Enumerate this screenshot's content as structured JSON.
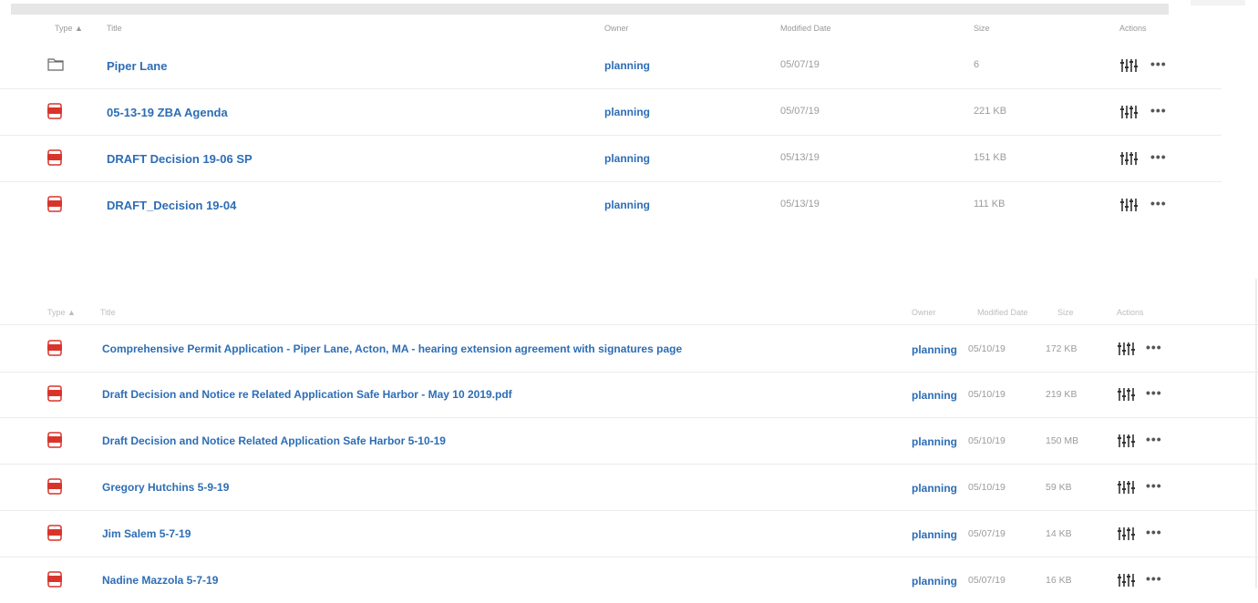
{
  "table_top": {
    "headers": {
      "type": "Type ▲",
      "title": "Title",
      "owner": "Owner",
      "modified": "Modified Date",
      "size": "Size",
      "actions": "Actions"
    },
    "rows": [
      {
        "icon": "folder-icon",
        "title": "Piper Lane",
        "owner": "planning",
        "modified": "05/07/19",
        "size": "6"
      },
      {
        "icon": "pdf-icon",
        "title": "05-13-19 ZBA Agenda",
        "owner": "planning",
        "modified": "05/07/19",
        "size": "221 KB"
      },
      {
        "icon": "pdf-icon",
        "title": "DRAFT Decision 19-06 SP",
        "owner": "planning",
        "modified": "05/13/19",
        "size": "151 KB"
      },
      {
        "icon": "pdf-icon",
        "title": "DRAFT_Decision 19-04",
        "owner": "planning",
        "modified": "05/13/19",
        "size": "111 KB"
      }
    ]
  },
  "table_bottom": {
    "headers": {
      "type": "Type ▲",
      "title": "Title",
      "owner": "Owner",
      "modified": "Modified Date",
      "size": "Size",
      "actions": "Actions"
    },
    "rows": [
      {
        "icon": "pdf-icon",
        "title": "Comprehensive Permit Application - Piper Lane, Acton, MA - hearing extension agreement with signatures page",
        "owner": "planning",
        "modified": "05/10/19",
        "size": "172 KB"
      },
      {
        "icon": "pdf-icon",
        "title": "Draft Decision and Notice re Related Application Safe Harbor - May 10 2019.pdf",
        "owner": "planning",
        "modified": "05/10/19",
        "size": "219 KB"
      },
      {
        "icon": "pdf-icon",
        "title": "Draft Decision and Notice Related Application Safe Harbor 5-10-19",
        "owner": "planning",
        "modified": "05/10/19",
        "size": "150 MB"
      },
      {
        "icon": "pdf-icon",
        "title": "Gregory Hutchins 5-9-19",
        "owner": "planning",
        "modified": "05/10/19",
        "size": "59 KB"
      },
      {
        "icon": "pdf-icon",
        "title": "Jim Salem 5-7-19",
        "owner": "planning",
        "modified": "05/07/19",
        "size": "14 KB"
      },
      {
        "icon": "pdf-icon",
        "title": "Nadine Mazzola 5-7-19",
        "owner": "planning",
        "modified": "05/07/19",
        "size": "16 KB"
      }
    ]
  },
  "actions": {
    "more_label": "•••"
  },
  "colors": {
    "link": "#2d6db5",
    "pdf": "#d9342b",
    "muted": "#9b9b9b"
  }
}
